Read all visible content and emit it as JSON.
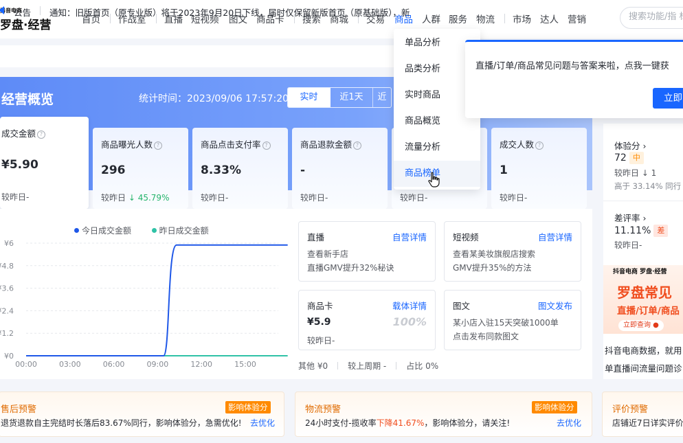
{
  "brand": {
    "small": "抖音电商",
    "name": "罗盘·经营"
  },
  "nav": [
    "首页",
    "作战室",
    "直播",
    "短视频",
    "图文",
    "商品卡",
    "搜索",
    "商城",
    "交易",
    "商品",
    "人群",
    "服务",
    "物流",
    "市场",
    "达人",
    "营销"
  ],
  "search": {
    "placeholder": "搜索功能/指 标"
  },
  "notice": {
    "label": "公告",
    "text": "通知：旧版首页（原专业版）将于2023年9月20日下线，届时仅保留新版首页（原基础版），新"
  },
  "overview": {
    "title": "经营概览",
    "stat_time": "统计时间：2023/09/06 17:57:20",
    "tabs": [
      "实时",
      "近1天",
      "近"
    ]
  },
  "metrics": [
    {
      "label": "成交金额",
      "value": "¥5.90",
      "compare": "较昨日-"
    },
    {
      "label": "商品曝光人数",
      "value": "296",
      "compare_prefix": "较昨日",
      "compare_change": "↓ 45.79%"
    },
    {
      "label": "商品点击支付率",
      "value": "8.33%",
      "compare": "较昨日-"
    },
    {
      "label": "商品退款金额",
      "value": "-",
      "compare": "较昨日-"
    },
    {
      "label": "",
      "value": "",
      "compare": "较昨日-"
    },
    {
      "label": "成交人数",
      "value": "1",
      "compare": "较昨日-"
    }
  ],
  "dropdown": [
    "单品分析",
    "品类分析",
    "实时商品",
    "商品概览",
    "流量分析",
    "商品榜单"
  ],
  "popup": {
    "text": "直播/订单/商品常见问题与答案来啦，点我一键获",
    "button": "立即"
  },
  "legend": {
    "today": "今日成交金额",
    "yesterday": "昨日成交金额"
  },
  "chart_data": {
    "type": "line",
    "x": [
      "00:00",
      "03:00",
      "06:00",
      "09:00",
      "12:00",
      "15:00"
    ],
    "y_ticks": [
      "¥6",
      "¥4.8",
      "¥3.6",
      "¥2.4",
      "¥1.2",
      "¥0"
    ],
    "ylim": [
      0,
      6
    ],
    "series": [
      {
        "name": "今日成交金额",
        "color": "#1e57e8",
        "points": [
          [
            0,
            0
          ],
          [
            9.4,
            0
          ],
          [
            10.3,
            5.9
          ],
          [
            17.9,
            5.9
          ]
        ]
      },
      {
        "name": "昨日成交金额",
        "color": "#2fc2a6",
        "points": [
          [
            0,
            0
          ],
          [
            17.9,
            0
          ]
        ]
      }
    ]
  },
  "cards": {
    "live": {
      "title": "直播",
      "link": "自营详情",
      "line1": "查看新手店",
      "line2": "直播GMV提升32%秘诀"
    },
    "video": {
      "title": "短视频",
      "link": "自营详情",
      "line1": "查看某美妆旗舰店搜索",
      "line2": "GMV提升35%的方法"
    },
    "product_card": {
      "title": "商品卡",
      "link": "载体详情",
      "value": "¥5.9",
      "pct": "100%",
      "compare": "较昨日-"
    },
    "graphic": {
      "title": "图文",
      "link": "图文发布",
      "line1": "某小店入驻15天突破1000单",
      "line2": "点击发布同款图文"
    }
  },
  "bottom_stats": {
    "other": "其他 ¥0",
    "compare": "较上周期 -",
    "share": "占比 0%"
  },
  "right": {
    "exp_label": "体验分 ›",
    "exp_value": "72",
    "exp_tag": "中",
    "exp_compare": "较昨日 ↓ 1",
    "exp_rank": "高于 33.14% 同行",
    "bad_label": "差评率 ›",
    "bad_value": "11.11%",
    "bad_tag": "差",
    "bad_compare": "较昨日-"
  },
  "banner": {
    "logo": "抖音电商 罗盘·经营",
    "title": "罗盘常见",
    "subtitle": "直播/订单/商品",
    "button": "立即查询 ●",
    "text1": "抖音电商数据，就用",
    "text2": "单直播间流量问题诊"
  },
  "warnings": {
    "after_sale": {
      "title": "售后预警",
      "badge": "影响体验分",
      "text": "退货退款自主完结时长落后83.67%同行，影响体验分，急需优化!",
      "link": "去优化"
    },
    "logistics": {
      "title": "物流预警",
      "badge": "影响体验分",
      "text_pre": "24小时支付-揽收率",
      "text_red": "下降41.67%",
      "text_post": "，影响体验分，请关注!",
      "link": "去优化"
    },
    "review": {
      "title": "评价预警",
      "text": "店铺近7日详实评价"
    }
  },
  "colors": {
    "accent": "#1966ff",
    "warning": "#ff8a00",
    "danger": "#f04d1e"
  }
}
